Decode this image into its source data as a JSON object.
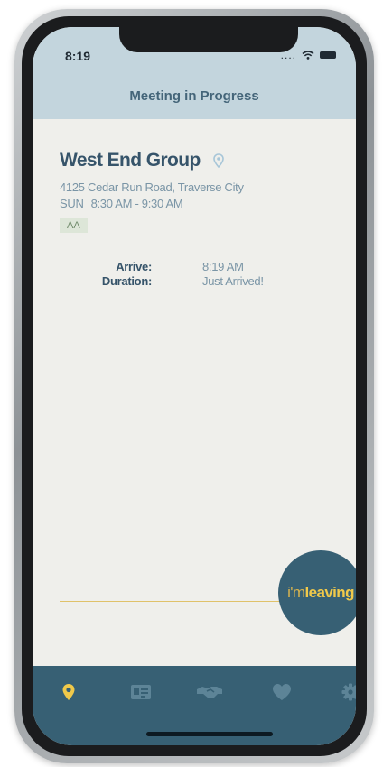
{
  "status_bar": {
    "time": "8:19",
    "signal": "...."
  },
  "header": {
    "title": "Meeting in Progress"
  },
  "meeting": {
    "name": "West End Group",
    "address": "4125 Cedar Run Road, Traverse City",
    "day": "SUN",
    "time_range": "8:30 AM - 9:30 AM",
    "tag": "AA"
  },
  "attendance": {
    "arrive_label": "Arrive:",
    "arrive_value": "8:19 AM",
    "duration_label": "Duration:",
    "duration_value": "Just Arrived!"
  },
  "leave_button": {
    "prefix": "i'm",
    "action": "leaving"
  },
  "tab_bar": {
    "items": [
      {
        "icon": "map-pin-icon",
        "active": true
      },
      {
        "icon": "id-card-icon",
        "active": false
      },
      {
        "icon": "handshake-icon",
        "active": false
      },
      {
        "icon": "heart-icon",
        "active": false
      },
      {
        "icon": "gear-icon",
        "active": false
      }
    ]
  },
  "colors": {
    "header_bg": "#c3d5dd",
    "screen_bg": "#efefeb",
    "accent_blue": "#376074",
    "accent_yellow": "#f0c94a",
    "tab_active": "#f0c94a",
    "tab_inactive": "#5d8497"
  }
}
